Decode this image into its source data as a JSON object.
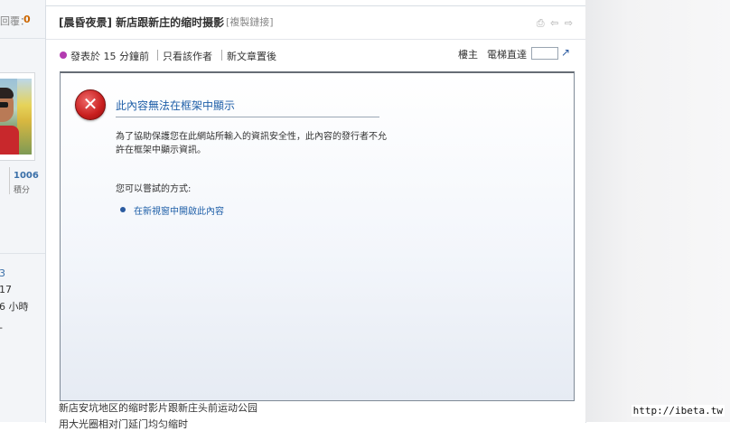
{
  "sidebar": {
    "reply_label": "回覆：",
    "reply_count": "0",
    "points_value": "1006",
    "points_label": "積分",
    "info_values": [
      "3",
      "17",
      "6 小時",
      "-"
    ]
  },
  "post": {
    "title": "[晨昏夜景] 新店跟新庄的缩时摄影",
    "copy_link": "[複製鏈接]",
    "tool_icons": [
      "⎙",
      "⇦",
      "⇨"
    ],
    "posted_time": "發表於 15 分鐘前",
    "only_author": "只看該作者",
    "new_first": "新文章置後",
    "floor_label": "樓主",
    "jump_label": "電梯直達",
    "jump_icon": "↗",
    "body_lines": [
      "新店安坑地区的缩时影片跟新庄头前运动公园",
      "用大光圈相对门延门均匀缩时"
    ]
  },
  "frame_error": {
    "icon": "✕",
    "title": "此內容無法在框架中顯示",
    "description": "為了協助保護您在此網站所輸入的資訊安全性，此內容的發行者不允許在框架中顯示資訊。",
    "try_heading": "您可以嘗試的方式:",
    "option_link": "在新視窗中開啟此內容"
  },
  "watermark": "http://ibeta.tw"
}
